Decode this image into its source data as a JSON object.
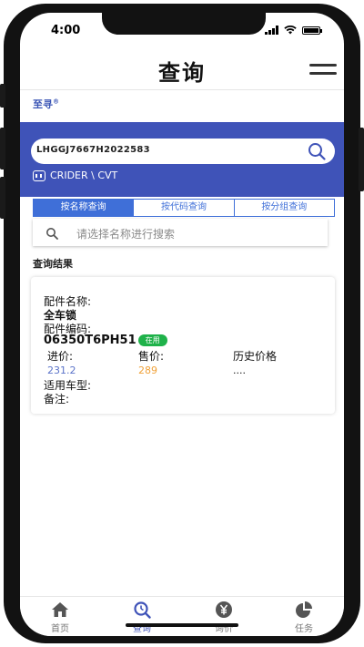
{
  "status_bar": {
    "time": "4:00"
  },
  "nav": {
    "title": "查询"
  },
  "brand": {
    "name": "至寻",
    "mark": "®"
  },
  "vin": {
    "value": "LHGGJ7667H2022583"
  },
  "vehicle": {
    "model": "CRIDER \\ CVT"
  },
  "tabs": [
    {
      "label": "按名称查询",
      "active": true
    },
    {
      "label": "按代码查询",
      "active": false
    },
    {
      "label": "按分组查询",
      "active": false
    }
  ],
  "search": {
    "placeholder": "请选择名称进行搜索"
  },
  "results": {
    "label": "查询结果"
  },
  "card": {
    "name_label": "配件名称:",
    "name_value": "全车锁",
    "code_label": "配件编码:",
    "code_value": "06350T6PH51",
    "status_badge": "在用",
    "purchase_label": "进价:",
    "purchase_value": "231.2",
    "sale_label": "售价:",
    "sale_value": "289",
    "history_label": "历史价格",
    "history_value": "....",
    "models_label": "适用车型:",
    "remark_label": "备注:"
  },
  "tabbar": [
    {
      "label": "首页",
      "icon": "home-icon"
    },
    {
      "label": "查询",
      "icon": "search-icon",
      "active": true
    },
    {
      "label": "询价",
      "icon": "yen-icon"
    },
    {
      "label": "任务",
      "icon": "pie-chart-icon"
    }
  ],
  "colors": {
    "primary": "#3f53b8",
    "tab_accent": "#3f6fd8",
    "badge_green": "#1fb24a",
    "price_blue": "#5b73c9",
    "price_orange": "#f0a23a"
  }
}
